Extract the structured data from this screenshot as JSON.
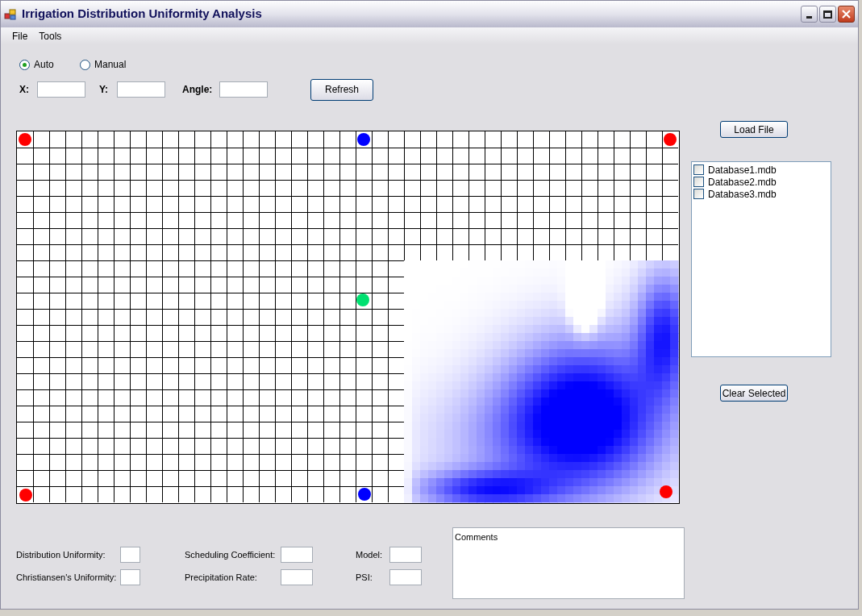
{
  "window": {
    "title": "Irrigation Distribution Uniformity Analysis"
  },
  "menu": [
    "File",
    "Tools"
  ],
  "mode": [
    {
      "label": "Auto",
      "selected": true
    },
    {
      "label": "Manual",
      "selected": false
    }
  ],
  "position_fields": [
    {
      "label": "X:"
    },
    {
      "label": "Y:"
    },
    {
      "label": "Angle:"
    }
  ],
  "refresh_button": "Refresh",
  "load_file_button": "Load File",
  "files": [
    {
      "name": "Database1.mdb",
      "checked": false
    },
    {
      "name": "Database2.mdb",
      "checked": false
    },
    {
      "name": "Database3.mdb",
      "checked": false
    }
  ],
  "clear_selected_button": "Clear Selected",
  "results": [
    {
      "label": "Distribution Uniformity:"
    },
    {
      "label": "Christiansen's Uniformity:"
    },
    {
      "label": "Scheduling Coefficient:"
    },
    {
      "label": "Precipitation Rate:"
    },
    {
      "label": "Model:"
    },
    {
      "label": "PSI:"
    }
  ],
  "comments": {
    "value": "Comments"
  }
}
